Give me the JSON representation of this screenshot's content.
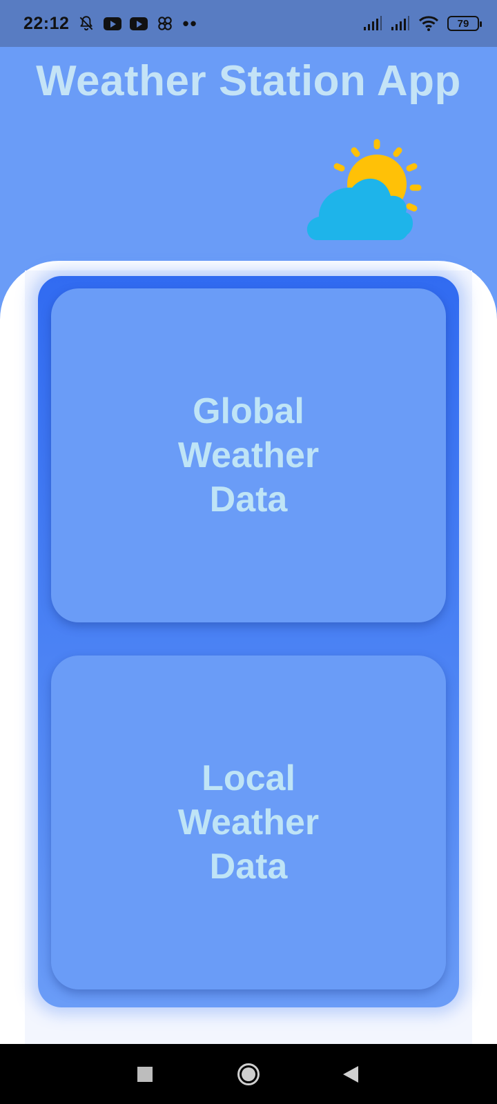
{
  "status_bar": {
    "time": "22:12",
    "left_icons": [
      "bell-muted-icon",
      "youtube-icon",
      "youtube-icon",
      "app-link-icon",
      "more-dots-icon"
    ],
    "more_dots": "••",
    "right_icons": [
      "signal-icon",
      "signal-icon",
      "wifi-icon",
      "battery-icon"
    ],
    "battery_level": "79"
  },
  "header": {
    "title": "Weather Station App",
    "illustration": "sun-behind-cloud-icon",
    "colors": {
      "sun": "#ffc107",
      "cloud": "#1eb4ea",
      "title": "#c4e3f6"
    }
  },
  "menu": {
    "cards": [
      {
        "id": "global",
        "label": "Global Weather Data"
      },
      {
        "id": "local",
        "label": "Local Weather Data"
      }
    ]
  },
  "nav_bar": {
    "buttons": [
      "recents-icon",
      "home-icon",
      "back-icon"
    ]
  },
  "theme": {
    "background": "#6a9cf7",
    "panel_top": "#316bf1",
    "card": "#6a9cf7",
    "status_bar": "#587cc2"
  }
}
